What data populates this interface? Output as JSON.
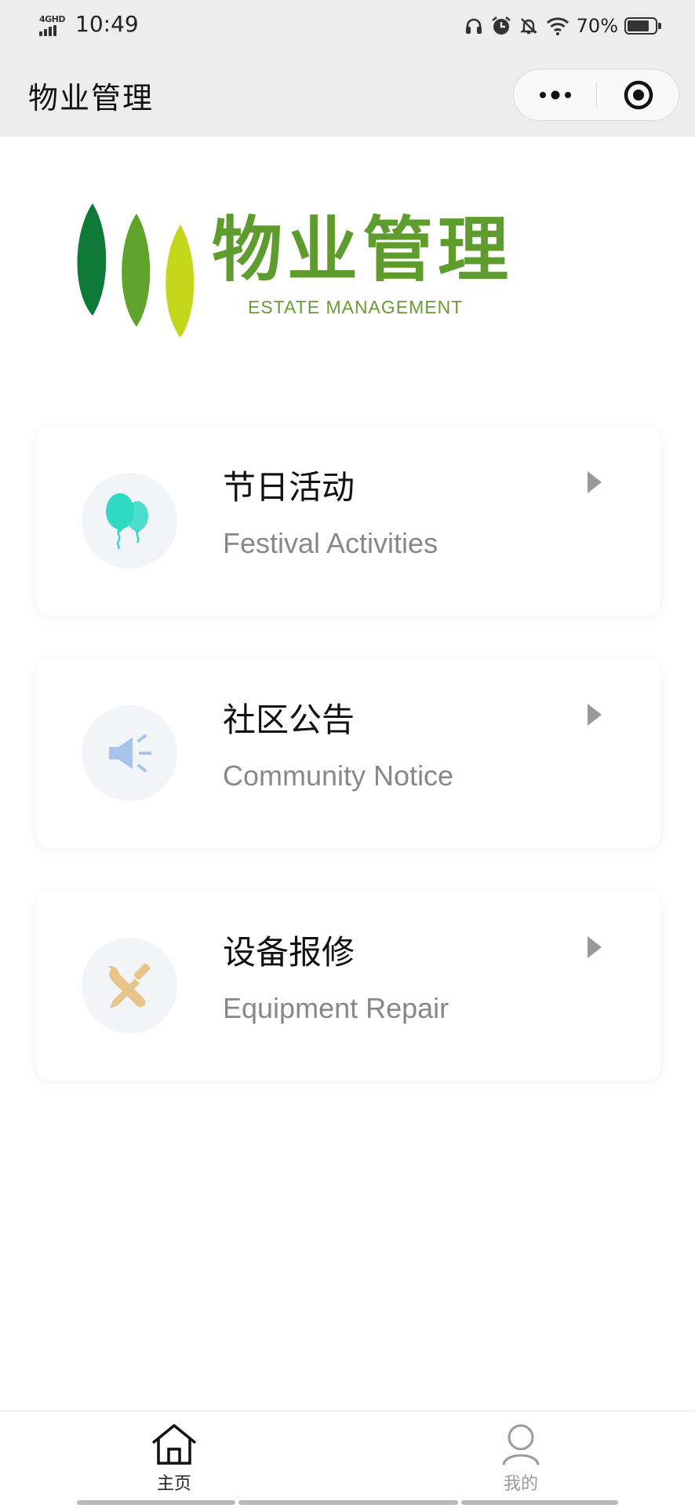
{
  "status_bar": {
    "network": "4GHD",
    "time": "10:49",
    "battery_percent": "70%",
    "icons": [
      "headphones-icon",
      "alarm-icon",
      "mute-notification-icon",
      "wifi-icon",
      "battery-icon"
    ]
  },
  "nav": {
    "title": "物业管理",
    "more_icon": "more-dots-icon",
    "close_icon": "target-icon"
  },
  "logo": {
    "cn": "物业管理",
    "en": "ESTATE MANAGEMENT",
    "leaf_colors": [
      "#0f7a37",
      "#5fa22c",
      "#c5d71a"
    ]
  },
  "menu": [
    {
      "title": "节日活动",
      "subtitle": "Festival Activities",
      "icon": "balloons-icon",
      "icon_color": "#2fd9c4"
    },
    {
      "title": "社区公告",
      "subtitle": "Community Notice",
      "icon": "megaphone-icon",
      "icon_color": "#a8c4ec"
    },
    {
      "title": "设备报修",
      "subtitle": "Equipment Repair",
      "icon": "tools-icon",
      "icon_color": "#e6c589"
    }
  ],
  "tab_bar": {
    "items": [
      {
        "label": "主页",
        "icon": "home-icon",
        "active": true
      },
      {
        "label": "我的",
        "icon": "user-icon",
        "active": false
      }
    ]
  }
}
